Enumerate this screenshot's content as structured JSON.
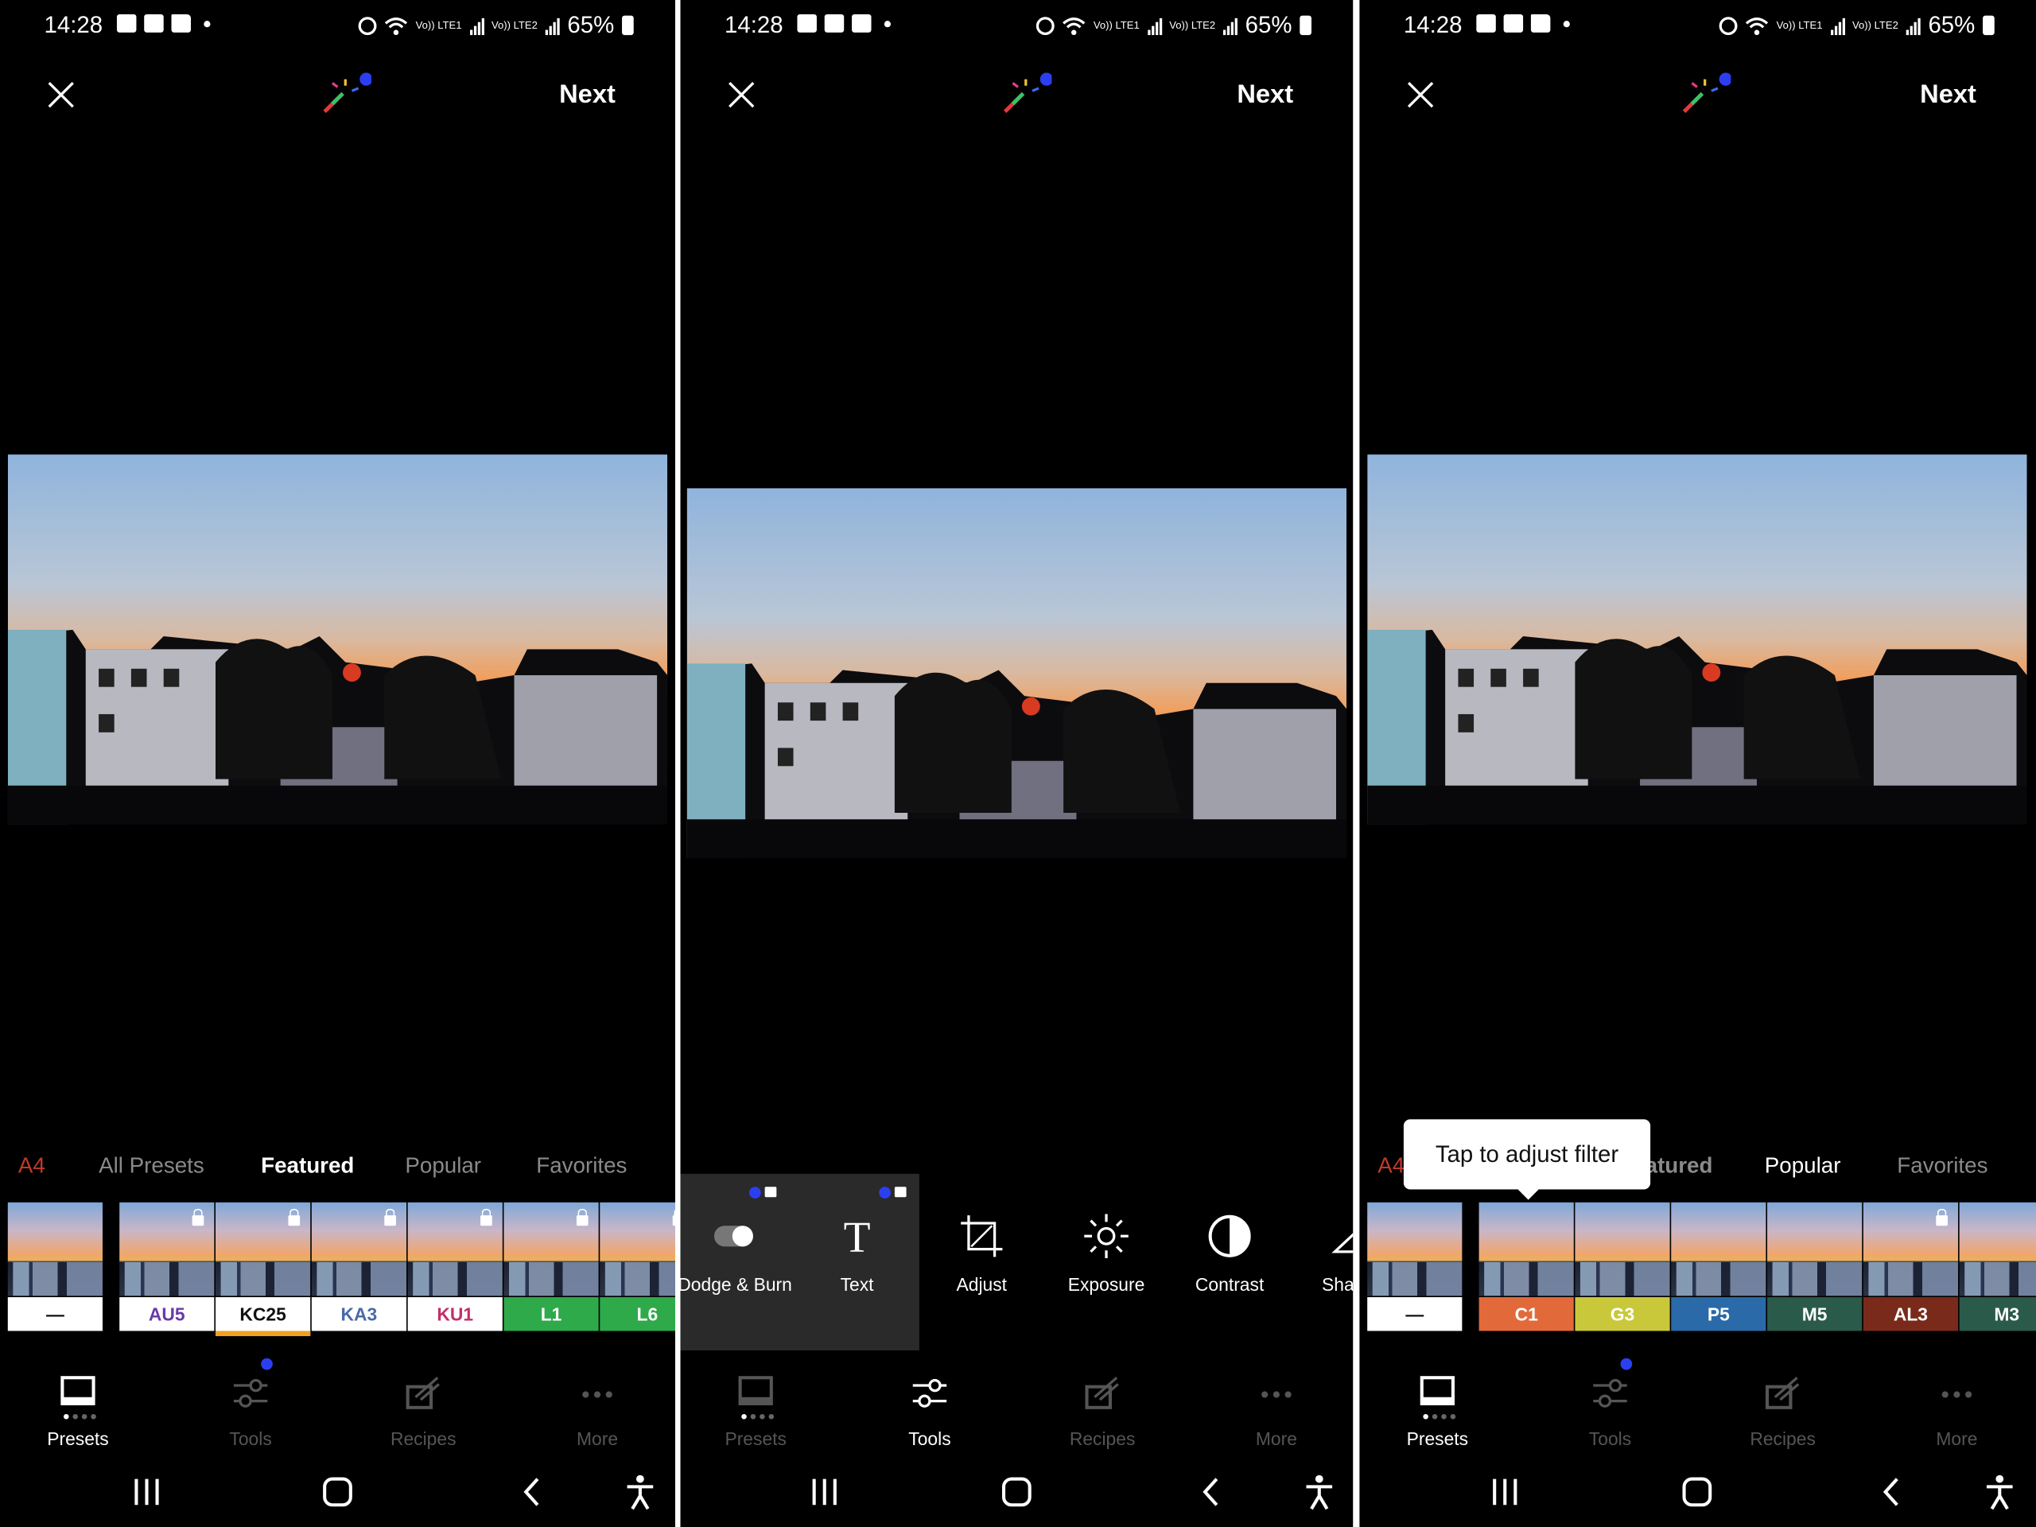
{
  "status_bar": {
    "time": "14:28",
    "battery": "65%",
    "lte1": "Vo)) LTE1",
    "lte2": "Vo)) LTE2"
  },
  "top_bar": {
    "next_label": "Next"
  },
  "tabs": {
    "a4": "A4",
    "all_presets": "All Presets",
    "featured": "Featured",
    "featured_partial": "atured",
    "popular": "Popular",
    "favorites": "Favorites"
  },
  "screen1_presets": [
    {
      "label": "—",
      "bg": "#ffffff",
      "color": "#111111",
      "locked": false
    },
    {
      "label": "AU5",
      "bg": "#ffffff",
      "color": "#6a3aa8",
      "locked": true
    },
    {
      "label": "KC25",
      "bg": "#ffffff",
      "color": "#111111",
      "locked": true,
      "selected": true
    },
    {
      "label": "KA3",
      "bg": "#ffffff",
      "color": "#4a6aa8",
      "locked": true
    },
    {
      "label": "KU1",
      "bg": "#ffffff",
      "color": "#c0306a",
      "locked": true
    },
    {
      "label": "L1",
      "bg": "#2eaa4a",
      "color": "#ffffff",
      "locked": true
    },
    {
      "label": "L6",
      "bg": "#2eaa4a",
      "color": "#ffffff",
      "locked": true
    }
  ],
  "screen3_presets": [
    {
      "label": "—",
      "bg": "#ffffff",
      "color": "#111111",
      "locked": false
    },
    {
      "label": "C1",
      "bg": "#e26a3a",
      "color": "#ffffff",
      "locked": false
    },
    {
      "label": "G3",
      "bg": "#c9c83a",
      "color": "#ffffff",
      "locked": false
    },
    {
      "label": "P5",
      "bg": "#2a6aa8",
      "color": "#ffffff",
      "locked": false
    },
    {
      "label": "M5",
      "bg": "#2a5a4a",
      "color": "#ffffff",
      "locked": false
    },
    {
      "label": "AL3",
      "bg": "#7a2a1a",
      "color": "#ffffff",
      "locked": true
    },
    {
      "label": "M3",
      "bg": "#2a5a4a",
      "color": "#ffffff",
      "locked": false
    }
  ],
  "tools": [
    {
      "label": "Dodge & Burn",
      "icon": "dodge-burn-icon",
      "premium": true
    },
    {
      "label": "Text",
      "icon": "text-icon",
      "premium": true
    },
    {
      "label": "Adjust",
      "icon": "crop-adjust-icon",
      "premium": false
    },
    {
      "label": "Exposure",
      "icon": "sun-icon",
      "premium": false
    },
    {
      "label": "Contrast",
      "icon": "contrast-icon",
      "premium": false
    },
    {
      "label": "Sha",
      "icon": "sharpen-icon",
      "premium": false
    }
  ],
  "bottom_nav": {
    "presets": "Presets",
    "tools": "Tools",
    "recipes": "Recipes",
    "more": "More"
  },
  "tooltip": {
    "text": "Tap to adjust filter"
  },
  "colors": {
    "accent_blue": "#2c3ff0",
    "a4_red": "#c0392b"
  }
}
